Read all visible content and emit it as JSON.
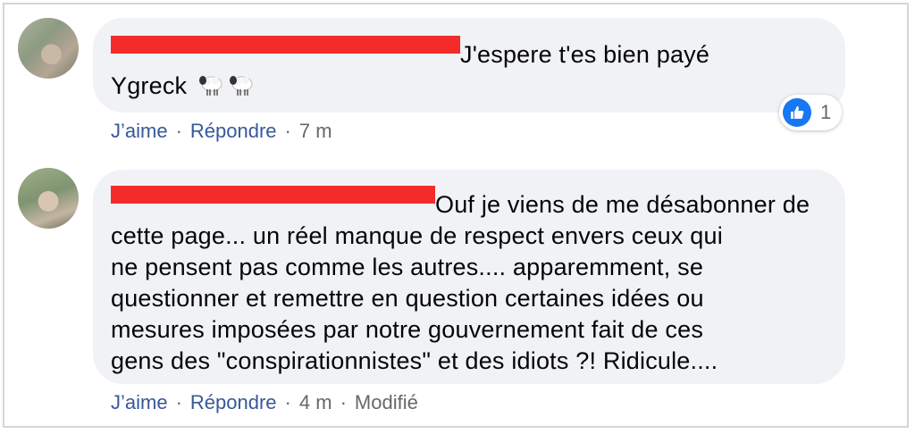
{
  "comments": [
    {
      "text_line1": "J'espere t'es bien payé",
      "text_line2": "Ygreck",
      "actions": {
        "like": "J’aime",
        "reply": "Répondre",
        "time": "7 m",
        "separator": "·"
      },
      "reaction_count": "1",
      "icons": [
        "sheep-emoji",
        "sheep-emoji",
        "like-icon"
      ]
    },
    {
      "text_lines": [
        "Ouf je viens de me désabonner de",
        "cette page... un réel manque de respect envers ceux qui",
        "ne pensent pas comme les autres.... apparemment, se",
        "questionner et remettre en question certaines idées ou",
        "mesures imposées par notre gouvernement fait de ces",
        "gens des \"conspirationnistes\" et des idiots ?! Ridicule...."
      ],
      "actions": {
        "like": "J’aime",
        "reply": "Répondre",
        "time": "4 m",
        "edited": "Modifié",
        "separator": "·"
      }
    }
  ],
  "colors": {
    "bubble": "#f0f2f5",
    "link": "#385898",
    "meta": "#65676b",
    "redaction": "#f32b2b",
    "like_blue": "#1877f2"
  }
}
